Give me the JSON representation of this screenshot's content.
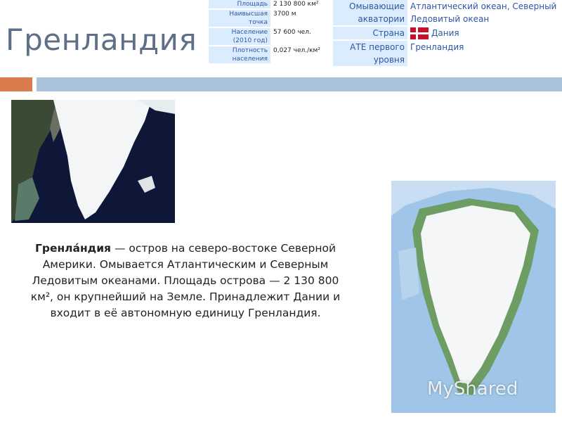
{
  "title": "Гренландия",
  "infobox_left": [
    {
      "label": "Площадь",
      "value": "2 130 800 км²"
    },
    {
      "label": "Наивысшая точка",
      "value": "3700 м"
    },
    {
      "label": "Население (2010 год)",
      "value": "57 600 чел."
    },
    {
      "label": "Плотность населения",
      "value": "0,027 чел./км²"
    }
  ],
  "infobox_right": [
    {
      "label": "Омывающие акватории",
      "value": "Атлантический океан, Северный Ледовитый океан"
    },
    {
      "label": "Страна",
      "value": "Дания"
    },
    {
      "label": "АТЕ первого уровня",
      "value": "Гренландия"
    }
  ],
  "description": {
    "term": "Гренла́ндия",
    "text": " — остров на северо-востоке Северной Америки. Омывается Атлантическим и Северным Ледовитым океанами. Площадь острова — 2 130 800 км², он крупнейший на Земле. Принадлежит Дании и входит в её автономную единицу Гренландия."
  },
  "watermark": "MyShared",
  "colors": {
    "accent_orange": "#d97b4a",
    "accent_blue": "#a9c3dd",
    "title": "#5f6f86"
  }
}
